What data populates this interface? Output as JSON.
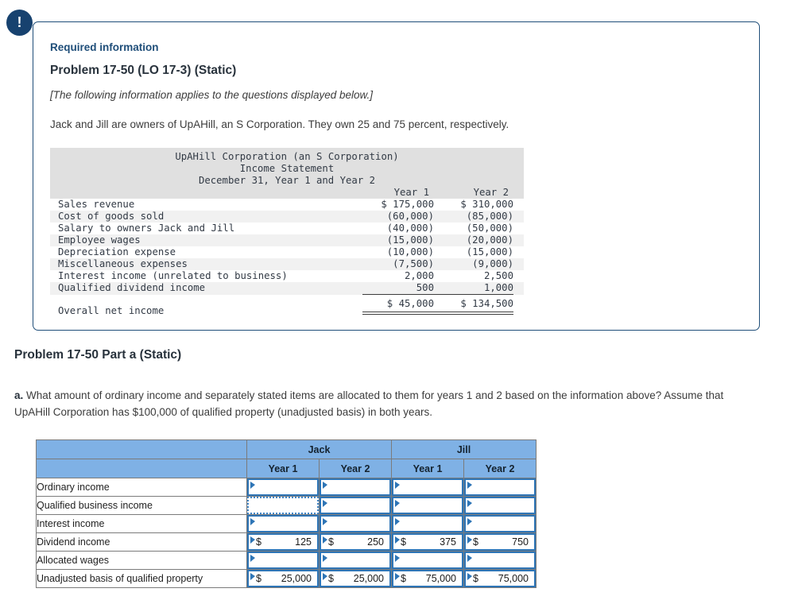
{
  "colors": {
    "panel_border": "#1f4e79",
    "alert_circle": "#17426f",
    "navy_heading": "#1f4e79",
    "statement_header_bg": "#e0e0e0",
    "statement_stripe_bg": "#f1f1f1",
    "answer_header_bg": "#7fb1e5",
    "input_border_blue": "#2e75b6"
  },
  "panel": {
    "alert_icon": "!",
    "required_label": "Required information",
    "problem_title": "Problem 17-50 (LO 17-3) (Static)",
    "note": "[The following information applies to the questions displayed below.]",
    "intro": "Jack and Jill are owners of UpAHill, an S Corporation. They own 25 and 75 percent, respectively."
  },
  "income_statement": {
    "title_line1": "UpAHill Corporation (an S Corporation)",
    "title_line2": "Income Statement",
    "title_line3": "December 31, Year 1 and Year 2",
    "col_headers": {
      "year1": "Year 1",
      "year2": "Year 2"
    },
    "rows": [
      {
        "label": "Sales revenue",
        "year1": "$ 175,000",
        "year2": "$ 310,000"
      },
      {
        "label": "Cost of goods sold",
        "year1": "(60,000)",
        "year2": "(85,000)"
      },
      {
        "label": "Salary to owners Jack and Jill",
        "year1": "(40,000)",
        "year2": "(50,000)"
      },
      {
        "label": "Employee wages",
        "year1": "(15,000)",
        "year2": "(20,000)"
      },
      {
        "label": "Depreciation expense",
        "year1": "(10,000)",
        "year2": "(15,000)"
      },
      {
        "label": "Miscellaneous expenses",
        "year1": "(7,500)",
        "year2": "(9,000)"
      },
      {
        "label": "Interest income (unrelated to business)",
        "year1": "2,000",
        "year2": "2,500"
      },
      {
        "label": "Qualified dividend income",
        "year1": "500",
        "year2": "1,000"
      }
    ],
    "total": {
      "label": "Overall net income",
      "year1": "$ 45,000",
      "year2": "$ 134,500"
    }
  },
  "part_a": {
    "heading": "Problem 17-50 Part a (Static)",
    "question_label": "a.",
    "question_text": "What amount of ordinary income and separately stated items are allocated to them for years 1 and 2 based on the information above? Assume that UpAHill Corporation has $100,000 of qualified property (unadjusted basis) in both years."
  },
  "answer_table": {
    "group_headers": [
      "Jack",
      "Jill"
    ],
    "year_headers": [
      "Year 1",
      "Year 2",
      "Year 1",
      "Year 2"
    ],
    "rows": [
      {
        "label": "Ordinary income",
        "cells": [
          {},
          {},
          {},
          {}
        ]
      },
      {
        "label": "Qualified business income",
        "cells": [
          {
            "focused": true
          },
          {},
          {},
          {}
        ]
      },
      {
        "label": "Interest income",
        "cells": [
          {},
          {},
          {},
          {}
        ]
      },
      {
        "label": "Dividend income",
        "cells": [
          {
            "prefix": "$",
            "value": "125"
          },
          {
            "prefix": "$",
            "value": "250"
          },
          {
            "prefix": "$",
            "value": "375"
          },
          {
            "prefix": "$",
            "value": "750"
          }
        ]
      },
      {
        "label": "Allocated wages",
        "cells": [
          {},
          {},
          {},
          {}
        ]
      },
      {
        "label": "Unadjusted basis of qualified property",
        "cells": [
          {
            "prefix": "$",
            "value": "25,000"
          },
          {
            "prefix": "$",
            "value": "25,000"
          },
          {
            "prefix": "$",
            "value": "75,000"
          },
          {
            "prefix": "$",
            "value": "75,000"
          }
        ]
      }
    ]
  }
}
